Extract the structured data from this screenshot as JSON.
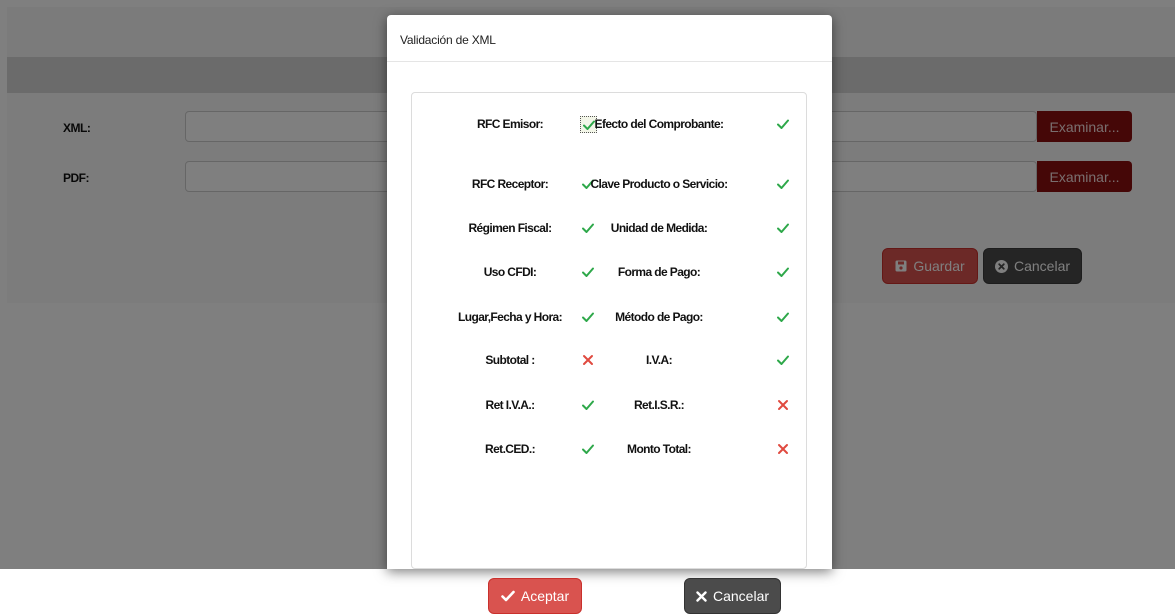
{
  "page": {
    "xml_label": "XML:",
    "pdf_label": "PDF:",
    "browse_label": "Examinar...",
    "save_label": "Guardar",
    "cancel_label": "Cancelar"
  },
  "modal": {
    "title": "Validación de XML",
    "checks_left": [
      {
        "label": "RFC Emisor:",
        "status": "ok",
        "icon": "check-icon"
      },
      {
        "label": "RFC Receptor:",
        "status": "ok",
        "icon": "check-icon"
      },
      {
        "label": "Régimen Fiscal:",
        "status": "ok",
        "icon": "check-icon"
      },
      {
        "label": "Uso CFDI:",
        "status": "ok",
        "icon": "check-icon"
      },
      {
        "label": "Lugar,Fecha y Hora:",
        "status": "ok",
        "icon": "check-icon"
      },
      {
        "label": "Subtotal :",
        "status": "error",
        "icon": "x-icon"
      },
      {
        "label": "Ret I.V.A.:",
        "status": "ok",
        "icon": "check-icon"
      },
      {
        "label": "Ret.CED.:",
        "status": "ok",
        "icon": "check-icon"
      }
    ],
    "checks_right": [
      {
        "label": "Efecto del Comprobante:",
        "status": "ok",
        "icon": "check-icon"
      },
      {
        "label": "Clave Producto o Servicio:",
        "status": "ok",
        "icon": "check-icon"
      },
      {
        "label": "Unidad de Medida:",
        "status": "ok",
        "icon": "check-icon"
      },
      {
        "label": "Forma de Pago:",
        "status": "ok",
        "icon": "check-icon"
      },
      {
        "label": "Método de Pago:",
        "status": "ok",
        "icon": "check-icon"
      },
      {
        "label": "I.V.A:",
        "status": "ok",
        "icon": "check-icon"
      },
      {
        "label": "Ret.I.S.R.:",
        "status": "error",
        "icon": "x-icon"
      },
      {
        "label": "Monto Total:",
        "status": "error",
        "icon": "x-icon"
      }
    ],
    "accept_label": "Aceptar",
    "cancel_label": "Cancelar"
  },
  "colors": {
    "ok": "#2ea84a",
    "error": "#e04a3f",
    "accept": "#d9534f",
    "cancel": "#4b4b4b",
    "browse": "#8b0f0f"
  }
}
